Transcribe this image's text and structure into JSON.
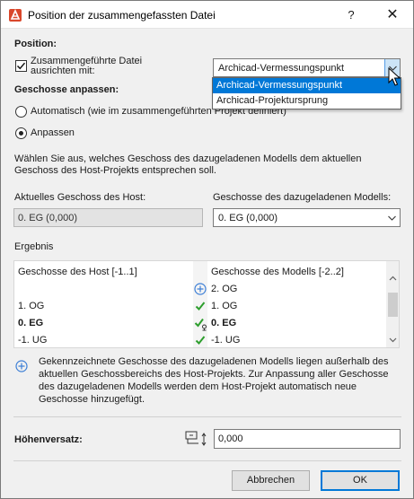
{
  "window": {
    "title": "Position der zusammengefassten Datei",
    "help_label": "?",
    "close_label": "✕"
  },
  "position": {
    "heading": "Position:",
    "align_checkbox_checked": true,
    "align_label_line1": "Zusammengeführte Datei",
    "align_label_line2": "ausrichten mit:",
    "align_select_value": "Archicad-Vermessungspunkt",
    "align_options": [
      "Archicad-Vermessungspunkt",
      "Archicad-Projektursprung"
    ]
  },
  "stories": {
    "heading": "Geschosse anpassen:",
    "radio_auto_label": "Automatisch (wie im zusammengeführten Projekt definiert)",
    "radio_match_label": "Anpassen",
    "selected": "match",
    "description_line1": "Wählen Sie aus, welches Geschoss des dazugeladenen Modells dem aktuellen",
    "description_line2": "Geschoss des Host-Projekts entsprechen soll.",
    "host_current_label": "Aktuelles Geschoss des Host:",
    "host_current_value": "0. EG (0,000)",
    "model_stories_label": "Geschosse des dazugeladenen Modells:",
    "model_stories_value": "0. EG (0,000)"
  },
  "result": {
    "heading": "Ergebnis",
    "col_host": "Geschosse des Host [-1..1]",
    "col_model": "Geschosse des Modells [-2..2]",
    "rows": [
      {
        "host": "",
        "model": "2. OG",
        "status": "plus"
      },
      {
        "host": "1. OG",
        "model": "1. OG",
        "status": "check"
      },
      {
        "host": "0. EG",
        "model": "0. EG",
        "status": "check-anchor"
      },
      {
        "host": "-1. UG",
        "model": "-1. UG",
        "status": "check"
      }
    ]
  },
  "info": {
    "line1": "Gekennzeichnete Geschosse des dazugeladenen Modells liegen außerhalb des",
    "line2": "aktuellen Geschossbereichs des Host-Projekts. Zur Anpassung aller Geschosse",
    "line3": "des dazugeladenen Modells werden dem Host-Projekt automatisch neue",
    "line4": "Geschosse hinzugefügt."
  },
  "elevation": {
    "label": "Höhenversatz:",
    "value": "0,000"
  },
  "buttons": {
    "cancel": "Abbrechen",
    "ok": "OK"
  },
  "colors": {
    "accent": "#0078d7",
    "check_green": "#2d9e2d",
    "plus_blue": "#3d7fd6"
  }
}
